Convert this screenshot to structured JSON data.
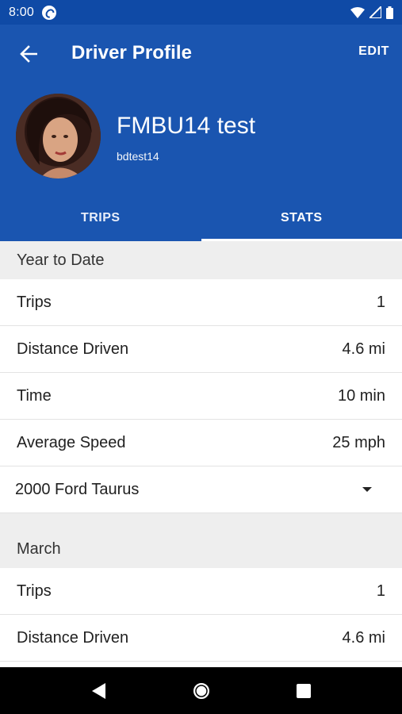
{
  "status_bar": {
    "time": "8:00",
    "icons": [
      "app-notification-icon",
      "wifi-icon",
      "signal-icon",
      "battery-icon"
    ]
  },
  "app_bar": {
    "title": "Driver Profile",
    "edit_label": "EDIT",
    "back_icon": "arrow-back-icon"
  },
  "profile": {
    "name": "FMBU14 test",
    "username": "bdtest14"
  },
  "tabs": [
    {
      "label": "TRIPS",
      "active": false
    },
    {
      "label": "STATS",
      "active": true
    }
  ],
  "sections": [
    {
      "title": "Year to Date",
      "rows": [
        {
          "label": "Trips",
          "value": "1"
        },
        {
          "label": "Distance Driven",
          "value": "4.6 mi"
        },
        {
          "label": "Time",
          "value": "10 min"
        },
        {
          "label": "Average Speed",
          "value": "25 mph"
        }
      ],
      "vehicle_select": "2000 Ford Taurus"
    },
    {
      "title": "March",
      "rows": [
        {
          "label": "Trips",
          "value": "1"
        },
        {
          "label": "Distance Driven",
          "value": "4.6 mi"
        }
      ]
    }
  ],
  "colors": {
    "primary": "#1a55b0",
    "status_bar": "#0f4aa6",
    "section_bg": "#eeeeee"
  }
}
